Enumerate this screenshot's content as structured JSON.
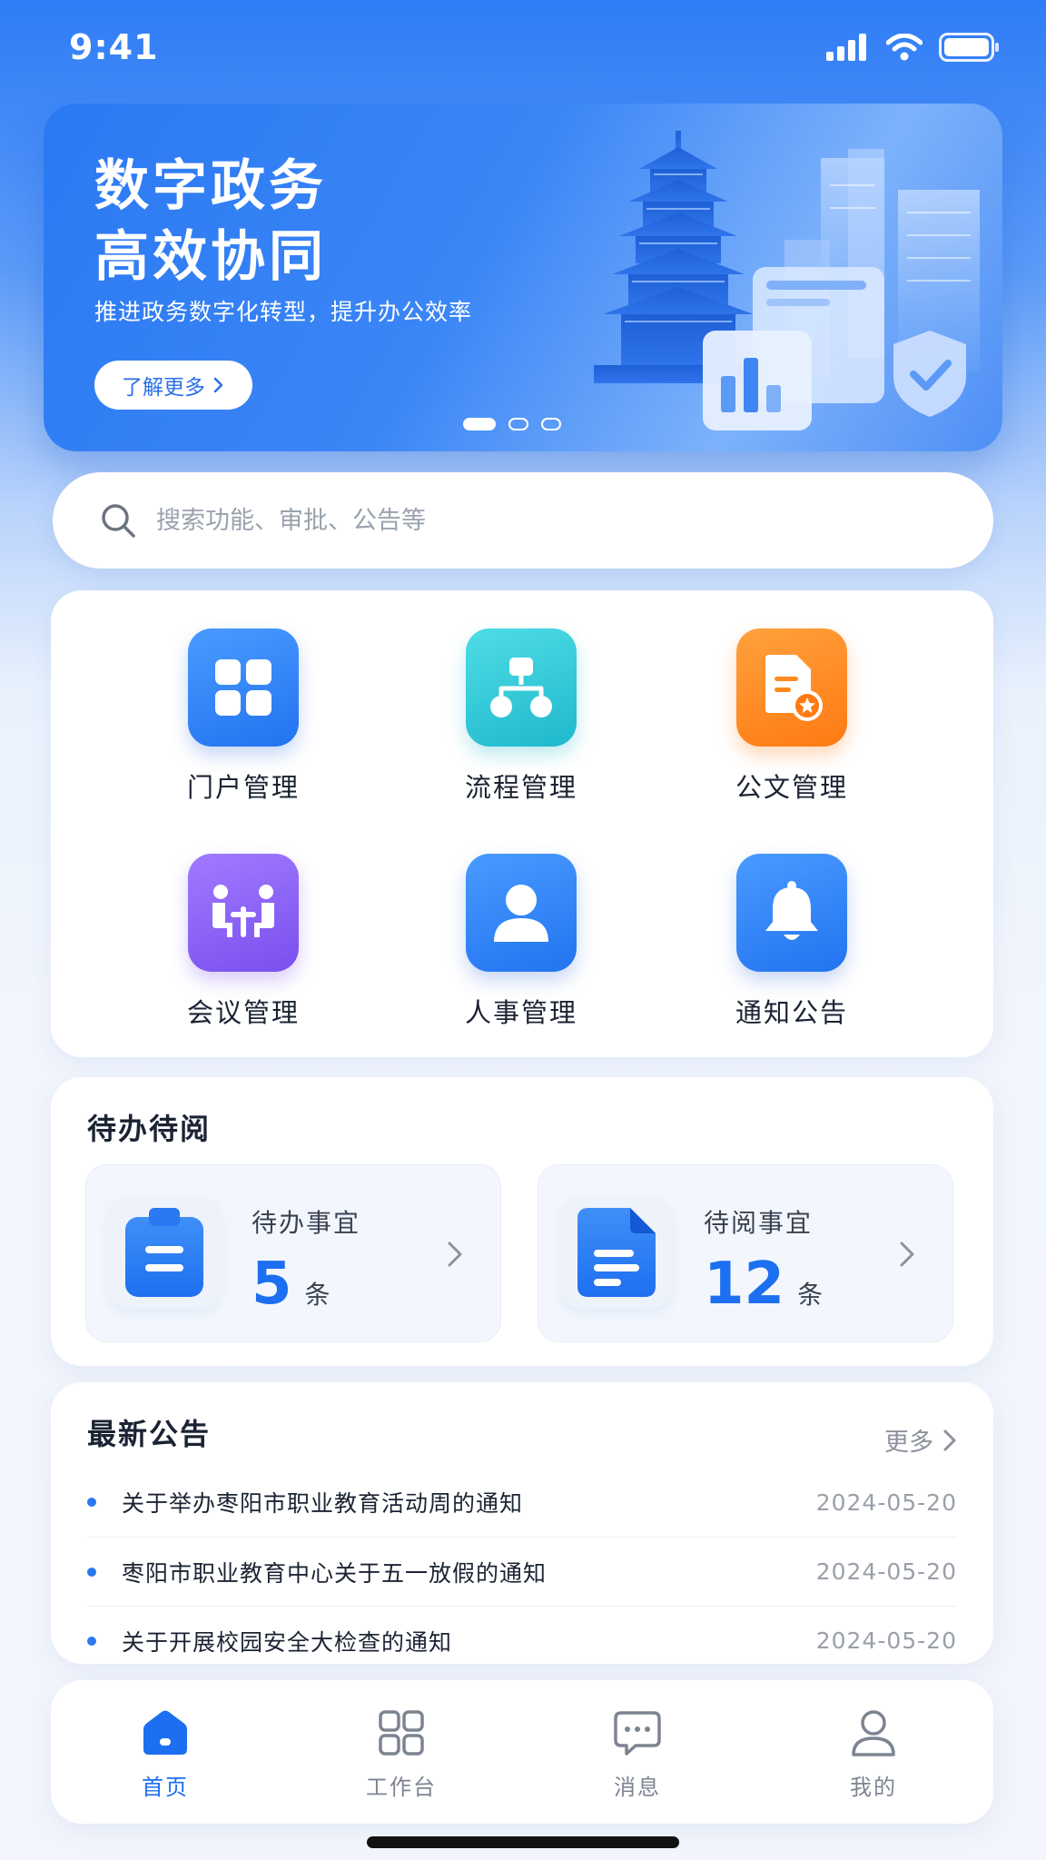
{
  "status_bar": {
    "time": "9:41"
  },
  "banner": {
    "title_line1": "数字政务",
    "title_line2": "高效协同",
    "subtitle": "推进政务数字化转型，提升办公效率",
    "button_label": "了解更多",
    "carousel_pages": 3,
    "active_page": 1
  },
  "search": {
    "placeholder": "搜索功能、审批、公告等"
  },
  "features": [
    {
      "label": "门户管理",
      "icon": "grid-icon",
      "color": "#3d8cf5"
    },
    {
      "label": "流程管理",
      "icon": "flowchart-icon",
      "color": "#2cc8d6"
    },
    {
      "label": "公文管理",
      "icon": "document-badge-icon",
      "color": "#ff8a1f"
    },
    {
      "label": "会议管理",
      "icon": "meeting-icon",
      "color": "#8a63f2"
    },
    {
      "label": "人事管理",
      "icon": "person-icon",
      "color": "#3d8cf5"
    },
    {
      "label": "通知公告",
      "icon": "bell-icon",
      "color": "#3d8cf5"
    }
  ],
  "todo": {
    "title": "待办待阅",
    "items": [
      {
        "label": "待办事宜",
        "count": "5",
        "unit": "条",
        "icon": "clipboard-icon"
      },
      {
        "label": "待阅事宜",
        "count": "12",
        "unit": "条",
        "icon": "file-icon"
      }
    ]
  },
  "notices": {
    "title": "最新公告",
    "more_label": "更多",
    "items": [
      {
        "title": "关于举办枣阳市职业教育活动周的通知",
        "date": "2024-05-20"
      },
      {
        "title": "枣阳市职业教育中心关于五一放假的通知",
        "date": "2024-05-20"
      },
      {
        "title": "关于开展校园安全大检查的通知",
        "date": "2024-05-20"
      }
    ]
  },
  "tabbar": {
    "items": [
      {
        "label": "首页",
        "icon": "home-icon",
        "active": true
      },
      {
        "label": "工作台",
        "icon": "apps-icon",
        "active": false
      },
      {
        "label": "消息",
        "icon": "message-icon",
        "active": false
      },
      {
        "label": "我的",
        "icon": "user-icon",
        "active": false
      }
    ]
  },
  "colors": {
    "primary": "#1c6ff0",
    "accent_orange": "#ff8a1f",
    "accent_teal": "#2cc8d6",
    "accent_purple": "#8a63f2"
  }
}
